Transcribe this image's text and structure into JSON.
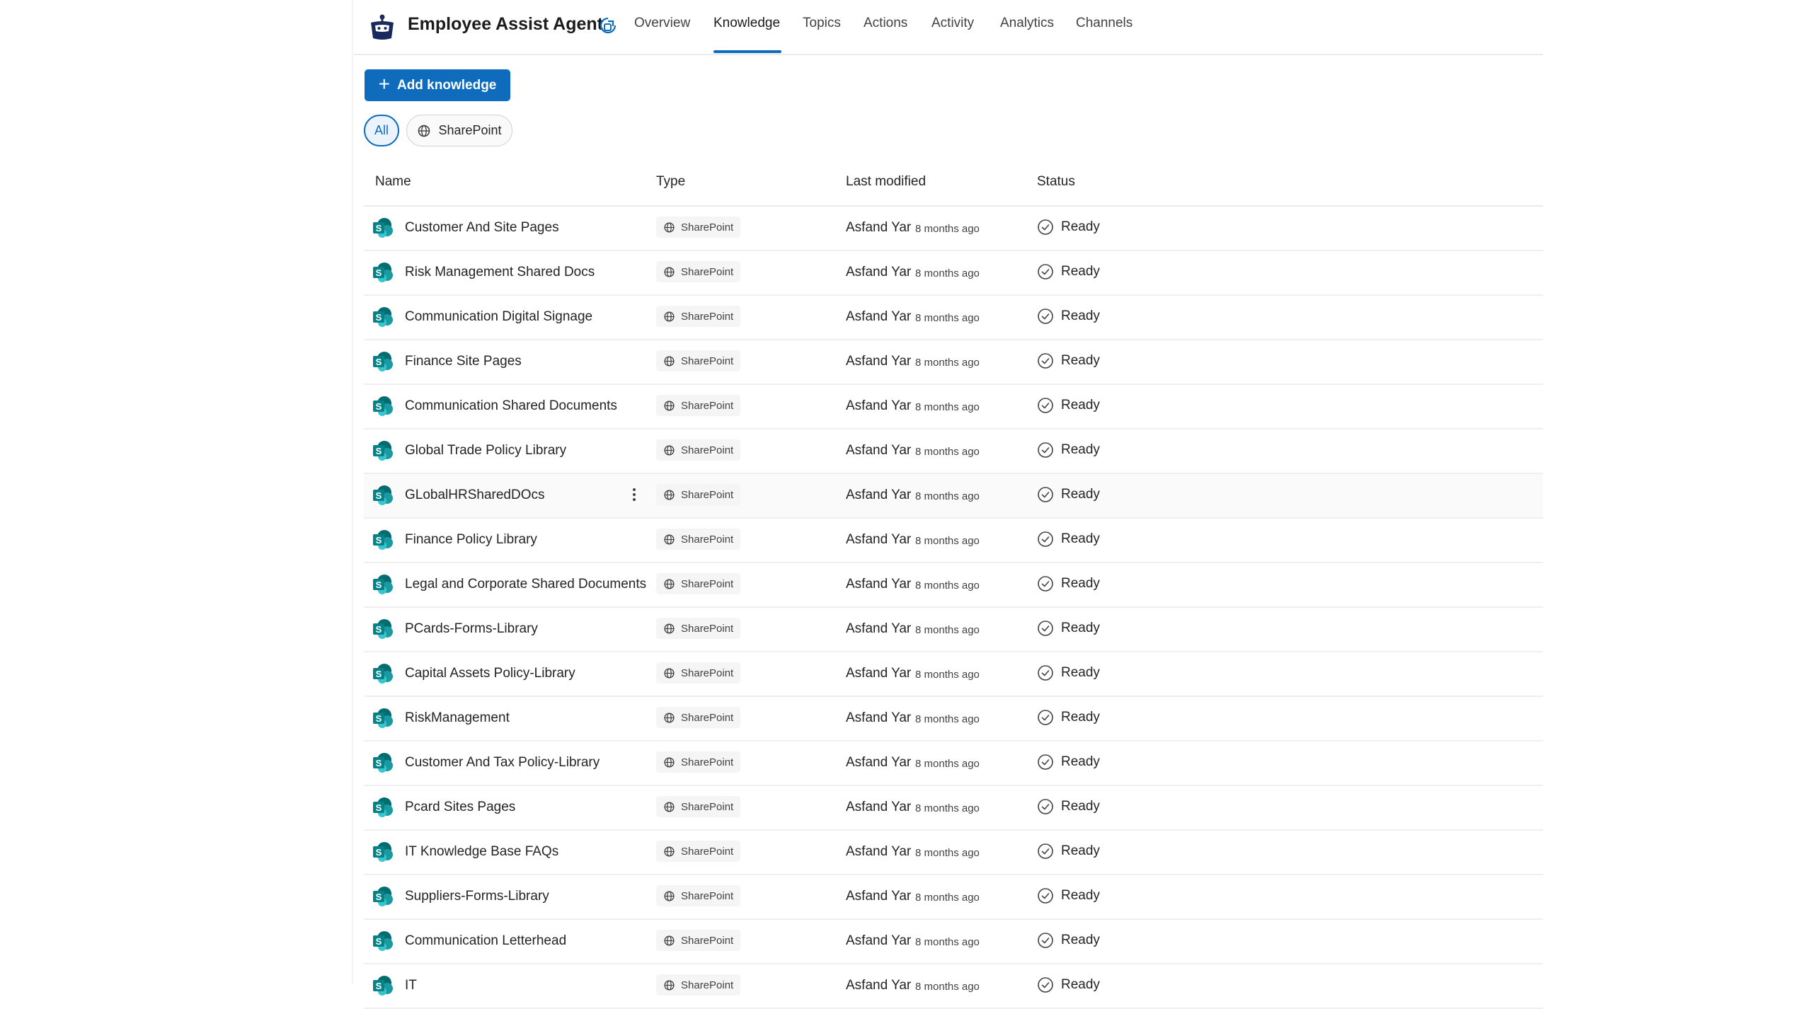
{
  "agent": {
    "name": "Employee Assist Agent",
    "icon": "robot-agent-icon"
  },
  "tabs": [
    {
      "label": "Overview",
      "active": false
    },
    {
      "label": "Knowledge",
      "active": true
    },
    {
      "label": "Topics",
      "active": false
    },
    {
      "label": "Actions",
      "active": false
    },
    {
      "label": "Activity",
      "active": false
    },
    {
      "label": "Analytics",
      "active": false
    },
    {
      "label": "Channels",
      "active": false
    }
  ],
  "toolbar": {
    "add_label": "Add knowledge"
  },
  "filters": {
    "all_label": "All",
    "sharepoint_label": "SharePoint",
    "selected": "All"
  },
  "columns": {
    "name": "Name",
    "type": "Type",
    "last_modified": "Last modified",
    "status": "Status"
  },
  "colors": {
    "accent": "#0f6cbd",
    "sharepoint": "#038387"
  },
  "rows": [
    {
      "name": "Customer And Site Pages",
      "type": "SharePoint",
      "modified_by": "Asfand Yar",
      "modified": "8 months ago",
      "status": "Ready"
    },
    {
      "name": "Risk Management Shared Docs",
      "type": "SharePoint",
      "modified_by": "Asfand Yar",
      "modified": "8 months ago",
      "status": "Ready"
    },
    {
      "name": "Communication Digital Signage",
      "type": "SharePoint",
      "modified_by": "Asfand Yar",
      "modified": "8 months ago",
      "status": "Ready"
    },
    {
      "name": "Finance Site Pages",
      "type": "SharePoint",
      "modified_by": "Asfand Yar",
      "modified": "8 months ago",
      "status": "Ready"
    },
    {
      "name": "Communication Shared Documents",
      "type": "SharePoint",
      "modified_by": "Asfand Yar",
      "modified": "8 months ago",
      "status": "Ready"
    },
    {
      "name": "Global Trade Policy Library",
      "type": "SharePoint",
      "modified_by": "Asfand Yar",
      "modified": "8 months ago",
      "status": "Ready"
    },
    {
      "name": "GLobalHRSharedDOcs",
      "type": "SharePoint",
      "modified_by": "Asfand Yar",
      "modified": "8 months ago",
      "status": "Ready",
      "hovered": true
    },
    {
      "name": "Finance Policy Library",
      "type": "SharePoint",
      "modified_by": "Asfand Yar",
      "modified": "8 months ago",
      "status": "Ready"
    },
    {
      "name": "Legal and Corporate Shared Documents",
      "type": "SharePoint",
      "modified_by": "Asfand Yar",
      "modified": "8 months ago",
      "status": "Ready"
    },
    {
      "name": "PCards-Forms-Library",
      "type": "SharePoint",
      "modified_by": "Asfand Yar",
      "modified": "8 months ago",
      "status": "Ready"
    },
    {
      "name": "Capital Assets Policy-Library",
      "type": "SharePoint",
      "modified_by": "Asfand Yar",
      "modified": "8 months ago",
      "status": "Ready"
    },
    {
      "name": "RiskManagement",
      "type": "SharePoint",
      "modified_by": "Asfand Yar",
      "modified": "8 months ago",
      "status": "Ready"
    },
    {
      "name": "Customer And Tax Policy-Library",
      "type": "SharePoint",
      "modified_by": "Asfand Yar",
      "modified": "8 months ago",
      "status": "Ready"
    },
    {
      "name": "Pcard Sites Pages",
      "type": "SharePoint",
      "modified_by": "Asfand Yar",
      "modified": "8 months ago",
      "status": "Ready"
    },
    {
      "name": "IT Knowledge Base FAQs",
      "type": "SharePoint",
      "modified_by": "Asfand Yar",
      "modified": "8 months ago",
      "status": "Ready"
    },
    {
      "name": "Suppliers-Forms-Library",
      "type": "SharePoint",
      "modified_by": "Asfand Yar",
      "modified": "8 months ago",
      "status": "Ready"
    },
    {
      "name": "Communication Letterhead",
      "type": "SharePoint",
      "modified_by": "Asfand Yar",
      "modified": "8 months ago",
      "status": "Ready"
    },
    {
      "name": "IT",
      "type": "SharePoint",
      "modified_by": "Asfand Yar",
      "modified": "8 months ago",
      "status": "Ready"
    }
  ]
}
